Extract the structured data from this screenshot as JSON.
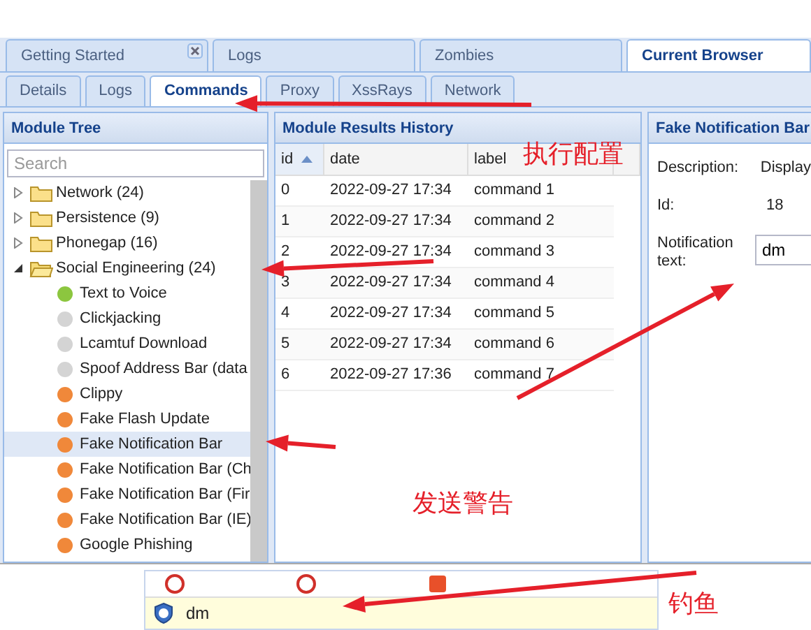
{
  "tabs": [
    {
      "label": "Getting Started",
      "selected": false,
      "closable": true
    },
    {
      "label": "Logs",
      "selected": false,
      "closable": false
    },
    {
      "label": "Zombies",
      "selected": false,
      "closable": false
    },
    {
      "label": "Current Browser",
      "selected": true,
      "closable": false
    }
  ],
  "subtabs": [
    {
      "label": "Details",
      "selected": false
    },
    {
      "label": "Logs",
      "selected": false
    },
    {
      "label": "Commands",
      "selected": true
    },
    {
      "label": "Proxy",
      "selected": false
    },
    {
      "label": "XssRays",
      "selected": false
    },
    {
      "label": "Network",
      "selected": false
    }
  ],
  "module_tree": {
    "title": "Module Tree",
    "search": {
      "placeholder": "Search"
    },
    "items": [
      {
        "label": "Network (24)",
        "expanded": false
      },
      {
        "label": "Persistence (9)",
        "expanded": false
      },
      {
        "label": "Phonegap (16)",
        "expanded": false
      },
      {
        "label": "Social Engineering (24)",
        "expanded": true,
        "children": [
          {
            "label": "Text to Voice",
            "color": "#8cc63f",
            "selected": false
          },
          {
            "label": "Clickjacking",
            "color": "#d4d4d4",
            "selected": false
          },
          {
            "label": "Lcamtuf Download",
            "color": "#d4d4d4",
            "selected": false
          },
          {
            "label": "Spoof Address Bar (data",
            "color": "#d4d4d4",
            "selected": false
          },
          {
            "label": "Clippy",
            "color": "#f0883a",
            "selected": false
          },
          {
            "label": "Fake Flash Update",
            "color": "#f0883a",
            "selected": false
          },
          {
            "label": "Fake Notification Bar",
            "color": "#f0883a",
            "selected": true
          },
          {
            "label": "Fake Notification Bar (Ch",
            "color": "#f0883a",
            "selected": false
          },
          {
            "label": "Fake Notification Bar (Fir",
            "color": "#f0883a",
            "selected": false
          },
          {
            "label": "Fake Notification Bar (IE)",
            "color": "#f0883a",
            "selected": false
          },
          {
            "label": "Google Phishing",
            "color": "#f0883a",
            "selected": false
          }
        ]
      }
    ]
  },
  "results": {
    "title": "Module Results History",
    "columns": [
      "id",
      "date",
      "label"
    ],
    "rows": [
      [
        "0",
        "2022-09-27 17:34",
        "command 1"
      ],
      [
        "1",
        "2022-09-27 17:34",
        "command 2"
      ],
      [
        "2",
        "2022-09-27 17:34",
        "command 3"
      ],
      [
        "3",
        "2022-09-27 17:34",
        "command 4"
      ],
      [
        "4",
        "2022-09-27 17:34",
        "command 5"
      ],
      [
        "5",
        "2022-09-27 17:34",
        "command 6"
      ],
      [
        "6",
        "2022-09-27 17:36",
        "command 7"
      ]
    ]
  },
  "module": {
    "title": "Fake Notification Bar",
    "fields": [
      {
        "kind": "text",
        "label": "Description:",
        "value": "Display"
      },
      {
        "kind": "text",
        "label": "Id:",
        "value": "18"
      },
      {
        "kind": "input",
        "label": "Notification text:",
        "value": "dm"
      }
    ]
  },
  "notification_popup": {
    "message": "dm"
  },
  "annotations": [
    {
      "text": "执行配置"
    },
    {
      "text": "发送警告"
    },
    {
      "text": "钓鱼"
    }
  ]
}
